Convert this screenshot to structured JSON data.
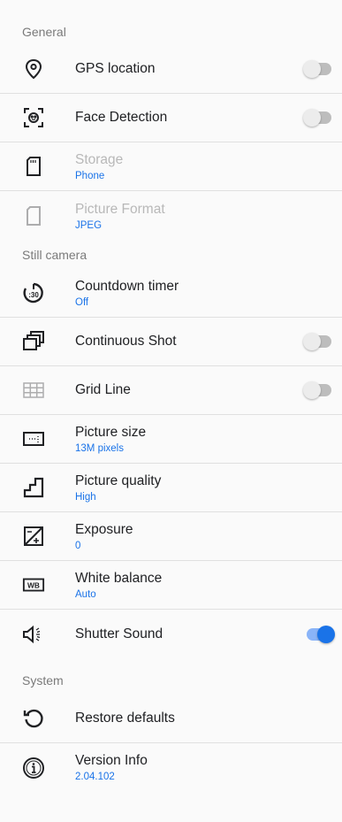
{
  "colors": {
    "accent": "#1a73e8",
    "section_header": "#7a7a7a",
    "divider": "#e0e0e0"
  },
  "sections": {
    "general": {
      "header": "General",
      "gps": {
        "label": "GPS location",
        "icon": "location-pin-icon",
        "toggle": "off"
      },
      "face": {
        "label": "Face Detection",
        "icon": "face-detection-icon",
        "toggle": "off"
      },
      "storage": {
        "label": "Storage",
        "value": "Phone",
        "icon": "sd-card-icon",
        "disabled": true
      },
      "format": {
        "label": "Picture Format",
        "value": "JPEG",
        "icon": "file-icon",
        "disabled": true
      }
    },
    "still": {
      "header": "Still camera",
      "countdown": {
        "label": "Countdown timer",
        "value": "Off",
        "icon": "timer-icon"
      },
      "continuous": {
        "label": "Continuous Shot",
        "icon": "burst-icon",
        "toggle": "off"
      },
      "grid": {
        "label": "Grid Line",
        "icon": "grid-icon",
        "toggle": "off"
      },
      "size": {
        "label": "Picture size",
        "value": "13M pixels",
        "icon": "picture-size-icon"
      },
      "quality": {
        "label": "Picture quality",
        "value": "High",
        "icon": "quality-stairs-icon"
      },
      "exposure": {
        "label": "Exposure",
        "value": "0",
        "icon": "exposure-icon"
      },
      "wb": {
        "label": "White balance",
        "value": "Auto",
        "icon": "white-balance-icon",
        "icon_text": "WB"
      },
      "shutter": {
        "label": "Shutter Sound",
        "icon": "speaker-icon",
        "toggle": "on"
      }
    },
    "system": {
      "header": "System",
      "restore": {
        "label": "Restore defaults",
        "icon": "restore-icon"
      },
      "version": {
        "label": "Version Info",
        "value": "2.04.102",
        "icon": "info-icon"
      }
    }
  }
}
